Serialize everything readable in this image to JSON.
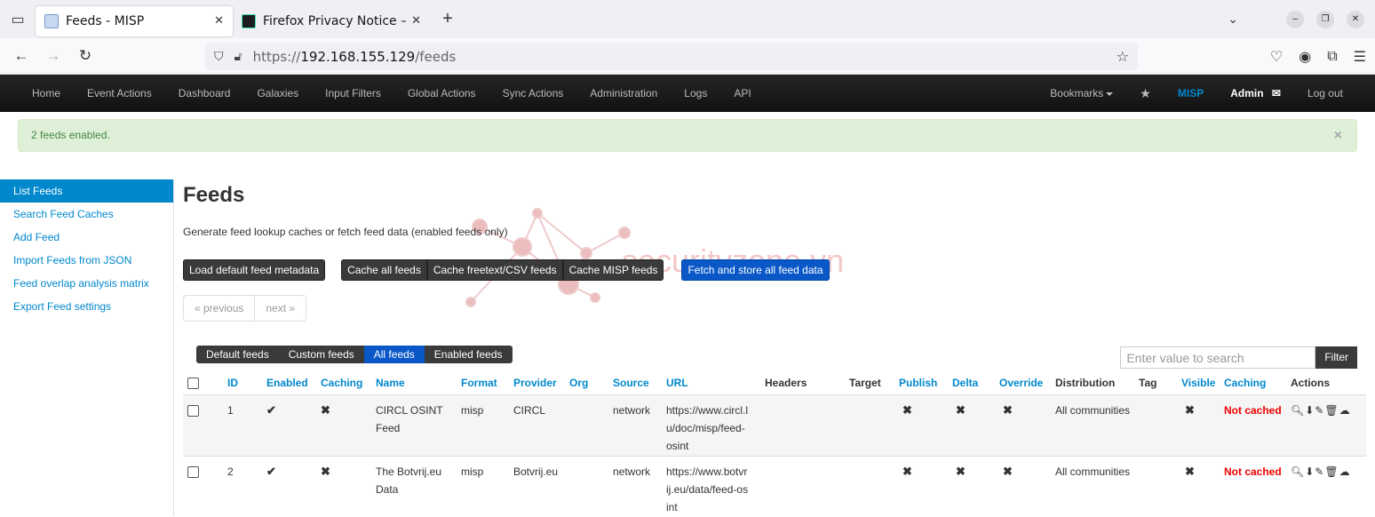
{
  "browser": {
    "tabs": [
      {
        "title": "Feeds - MISP",
        "active": true
      },
      {
        "title": "Firefox Privacy Notice —",
        "active": false
      }
    ],
    "url": {
      "scheme": "https://",
      "host": "192.168.155.129",
      "path": "/feeds"
    }
  },
  "topnav": {
    "items": [
      "Home",
      "Event Actions",
      "Dashboard",
      "Galaxies",
      "Input Filters",
      "Global Actions",
      "Sync Actions",
      "Administration",
      "Logs",
      "API"
    ],
    "bookmarks": "Bookmarks",
    "misp": "MISP",
    "admin": "Admin",
    "logout": "Log out"
  },
  "alert": {
    "message": "2 feeds enabled.",
    "close": "×"
  },
  "sidebar": {
    "items": [
      "List Feeds",
      "Search Feed Caches",
      "Add Feed",
      "Import Feeds from JSON",
      "Feed overlap analysis matrix",
      "Export Feed settings"
    ]
  },
  "main": {
    "title": "Feeds",
    "description": "Generate feed lookup caches or fetch feed data (enabled feeds only)",
    "buttons": {
      "load_default": "Load default feed metadata",
      "cache_all": "Cache all feeds",
      "cache_freetext": "Cache freetext/CSV feeds",
      "cache_misp": "Cache MISP feeds",
      "fetch_store": "Fetch and store all feed data"
    },
    "pager": {
      "previous": "« previous",
      "next": "next »"
    },
    "filter_tabs": [
      "Default feeds",
      "Custom feeds",
      "All feeds",
      "Enabled feeds"
    ],
    "search": {
      "placeholder": "Enter value to search",
      "button": "Filter"
    }
  },
  "table": {
    "headers": [
      "ID",
      "Enabled",
      "Caching",
      "Name",
      "Format",
      "Provider",
      "Org",
      "Source",
      "URL",
      "Headers",
      "Target",
      "Publish",
      "Delta",
      "Override",
      "Distribution",
      "Tag",
      "Visible",
      "Caching",
      "Actions"
    ],
    "rows": [
      {
        "id": "1",
        "enabled": "✔",
        "caching": "✖",
        "name": "CIRCL OSINT Feed",
        "format": "misp",
        "provider": "CIRCL",
        "org": "",
        "source": "network",
        "url": "https://www.circl.lu/doc/misp/feed-osint",
        "headers": "",
        "target": "",
        "publish": "✖",
        "delta": "✖",
        "override": "✖",
        "distribution": "All communities",
        "tag": "",
        "visible": "✖",
        "cache_status": "Not cached"
      },
      {
        "id": "2",
        "enabled": "✔",
        "caching": "✖",
        "name": "The Botvrij.eu Data",
        "format": "misp",
        "provider": "Botvrij.eu",
        "org": "",
        "source": "network",
        "url": "https://www.botvrij.eu/data/feed-osint",
        "headers": "",
        "target": "",
        "publish": "✖",
        "delta": "✖",
        "override": "✖",
        "distribution": "All communities",
        "tag": "",
        "visible": "✖",
        "cache_status": "Not cached"
      }
    ]
  },
  "watermark": "securityzone.vn"
}
